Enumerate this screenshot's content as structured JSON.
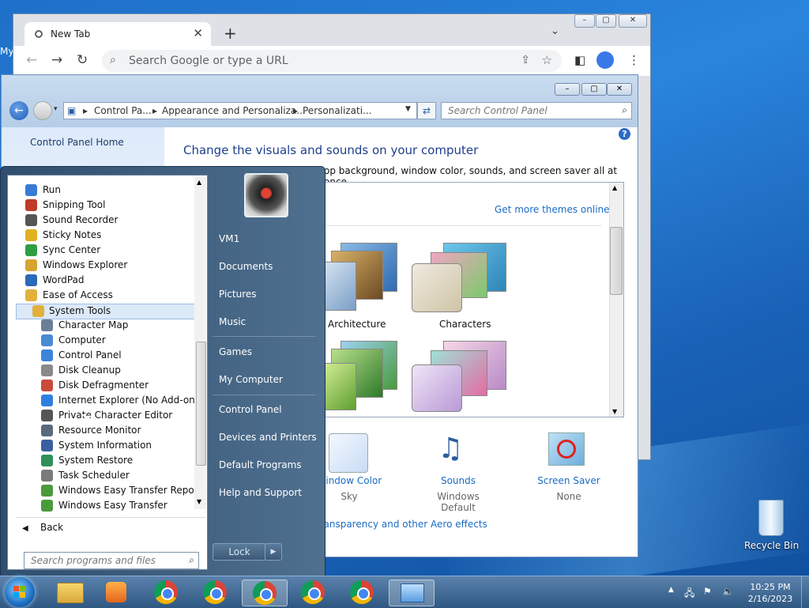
{
  "desktop": {
    "recycle_bin_label": "Recycle Bin",
    "left_edge_text": "My"
  },
  "chrome": {
    "tab_title": "New Tab",
    "omnibox_placeholder": "Search Google or type a URL",
    "buttons": {
      "minimize": "▭",
      "maximize": "▢",
      "close": "✕"
    }
  },
  "control_panel": {
    "breadcrumb": [
      "Control Pa...",
      "Appearance and Personaliza...",
      "Personalizati..."
    ],
    "search_placeholder": "Search Control Panel",
    "sidebar_home": "Control Panel Home",
    "heading": "Change the visuals and sounds on your computer",
    "subheading": "op background, window color, sounds, and screen saver all at once.",
    "get_more_themes": "Get more themes online",
    "themes": [
      {
        "label": "Architecture"
      },
      {
        "label": "Characters"
      }
    ],
    "bottom_items": [
      {
        "label": "Window Color",
        "value": "Sky"
      },
      {
        "label": "Sounds",
        "value": "Windows Default"
      },
      {
        "label": "Screen Saver",
        "value": "None"
      }
    ],
    "aero_link": "Transparency and other Aero effects",
    "help_icon": "?"
  },
  "start_menu": {
    "programs": [
      {
        "label": "Run",
        "indent": false
      },
      {
        "label": "Snipping Tool",
        "indent": false
      },
      {
        "label": "Sound Recorder",
        "indent": false
      },
      {
        "label": "Sticky Notes",
        "indent": false
      },
      {
        "label": "Sync Center",
        "indent": false
      },
      {
        "label": "Windows Explorer",
        "indent": false
      },
      {
        "label": "WordPad",
        "indent": false
      },
      {
        "label": "Ease of Access",
        "indent": false
      },
      {
        "label": "System Tools",
        "indent": false,
        "selected": true
      },
      {
        "label": "Character Map",
        "indent": true
      },
      {
        "label": "Computer",
        "indent": true
      },
      {
        "label": "Control Panel",
        "indent": true
      },
      {
        "label": "Disk Cleanup",
        "indent": true
      },
      {
        "label": "Disk Defragmenter",
        "indent": true
      },
      {
        "label": "Internet Explorer (No Add-ons)",
        "indent": true
      },
      {
        "label": "Private Character Editor",
        "indent": true
      },
      {
        "label": "Resource Monitor",
        "indent": true
      },
      {
        "label": "System Information",
        "indent": true
      },
      {
        "label": "System Restore",
        "indent": true
      },
      {
        "label": "Task Scheduler",
        "indent": true
      },
      {
        "label": "Windows Easy Transfer Reports",
        "indent": true
      },
      {
        "label": "Windows Easy Transfer",
        "indent": true
      }
    ],
    "back_label": "Back",
    "search_placeholder": "Search programs and files",
    "right_links": [
      "VM1",
      "Documents",
      "Pictures",
      "Music",
      "Games",
      "My Computer",
      "Control Panel",
      "Devices and Printers",
      "Default Programs",
      "Help and Support"
    ],
    "lock_label": "Lock"
  },
  "taskbar": {
    "time": "10:25 PM",
    "date": "2/16/2023"
  }
}
